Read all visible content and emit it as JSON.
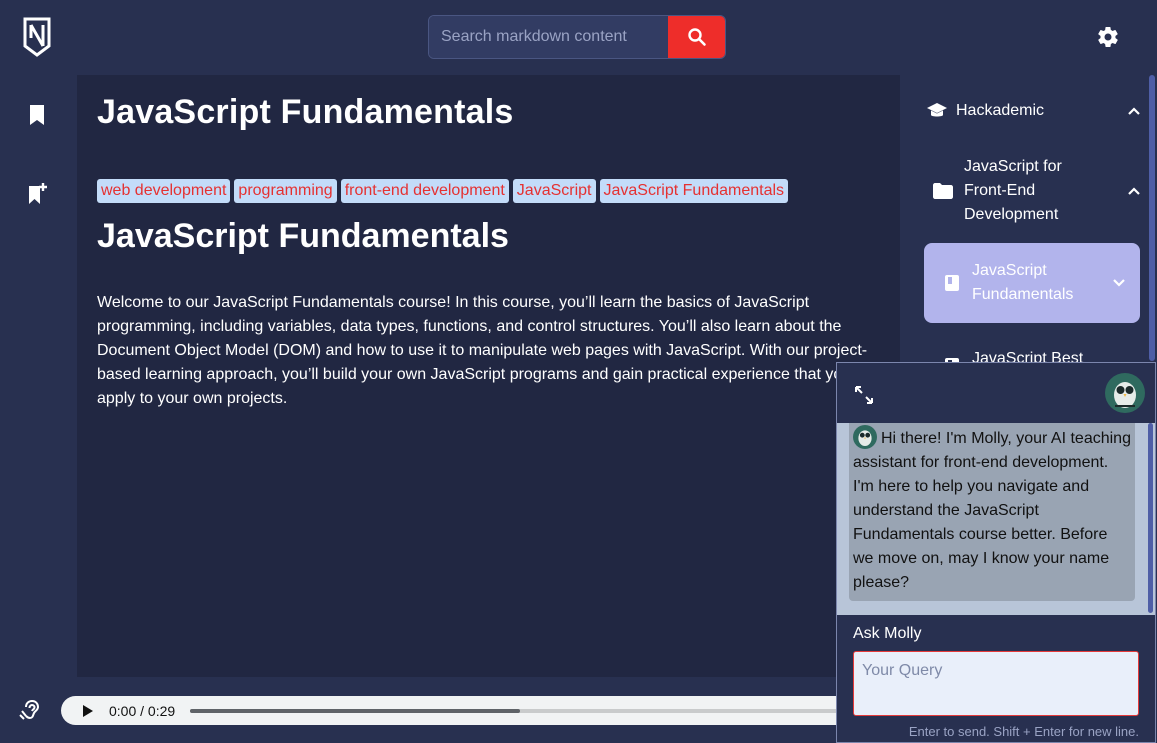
{
  "header": {
    "search_placeholder": "Search markdown content"
  },
  "main": {
    "title": "JavaScript Fundamentals",
    "tags": [
      "web development",
      "programming",
      "front-end development",
      "JavaScript",
      "JavaScript Fundamentals"
    ],
    "heading": "JavaScript Fundamentals",
    "paragraph": "Welcome to our JavaScript Fundamentals course! In this course, you’ll learn the basics of JavaScript programming, including variables, data types, functions, and control structures. You’ll also learn about the Document Object Model (DOM) and how to use it to manipulate web pages with JavaScript. With our project-based learning approach, you’ll build your own JavaScript programs and gain practical experience that you can apply to your own projects."
  },
  "sidebar": {
    "root": "Hackademic",
    "course": "JavaScript for Front-End Development",
    "active_item": "JavaScript Fundamentals",
    "next_item": "JavaScript Best"
  },
  "audio": {
    "time": "0:00 / 0:29",
    "progress": 0.5
  },
  "chat": {
    "message": "Hi there! I'm Molly, your AI teaching assistant for front-end development. I'm here to help you navigate and understand the JavaScript Fundamentals course better. Before we move on, may I know your name please?",
    "ask_label": "Ask Molly",
    "query_placeholder": "Your Query",
    "hint": "Enter to send. Shift + Enter for new line."
  },
  "colors": {
    "background": "#283050",
    "content": "#212742",
    "accent_red": "#ee2d2a",
    "tag_bg": "#c3dcf9",
    "active_item": "#b2b4ec"
  }
}
